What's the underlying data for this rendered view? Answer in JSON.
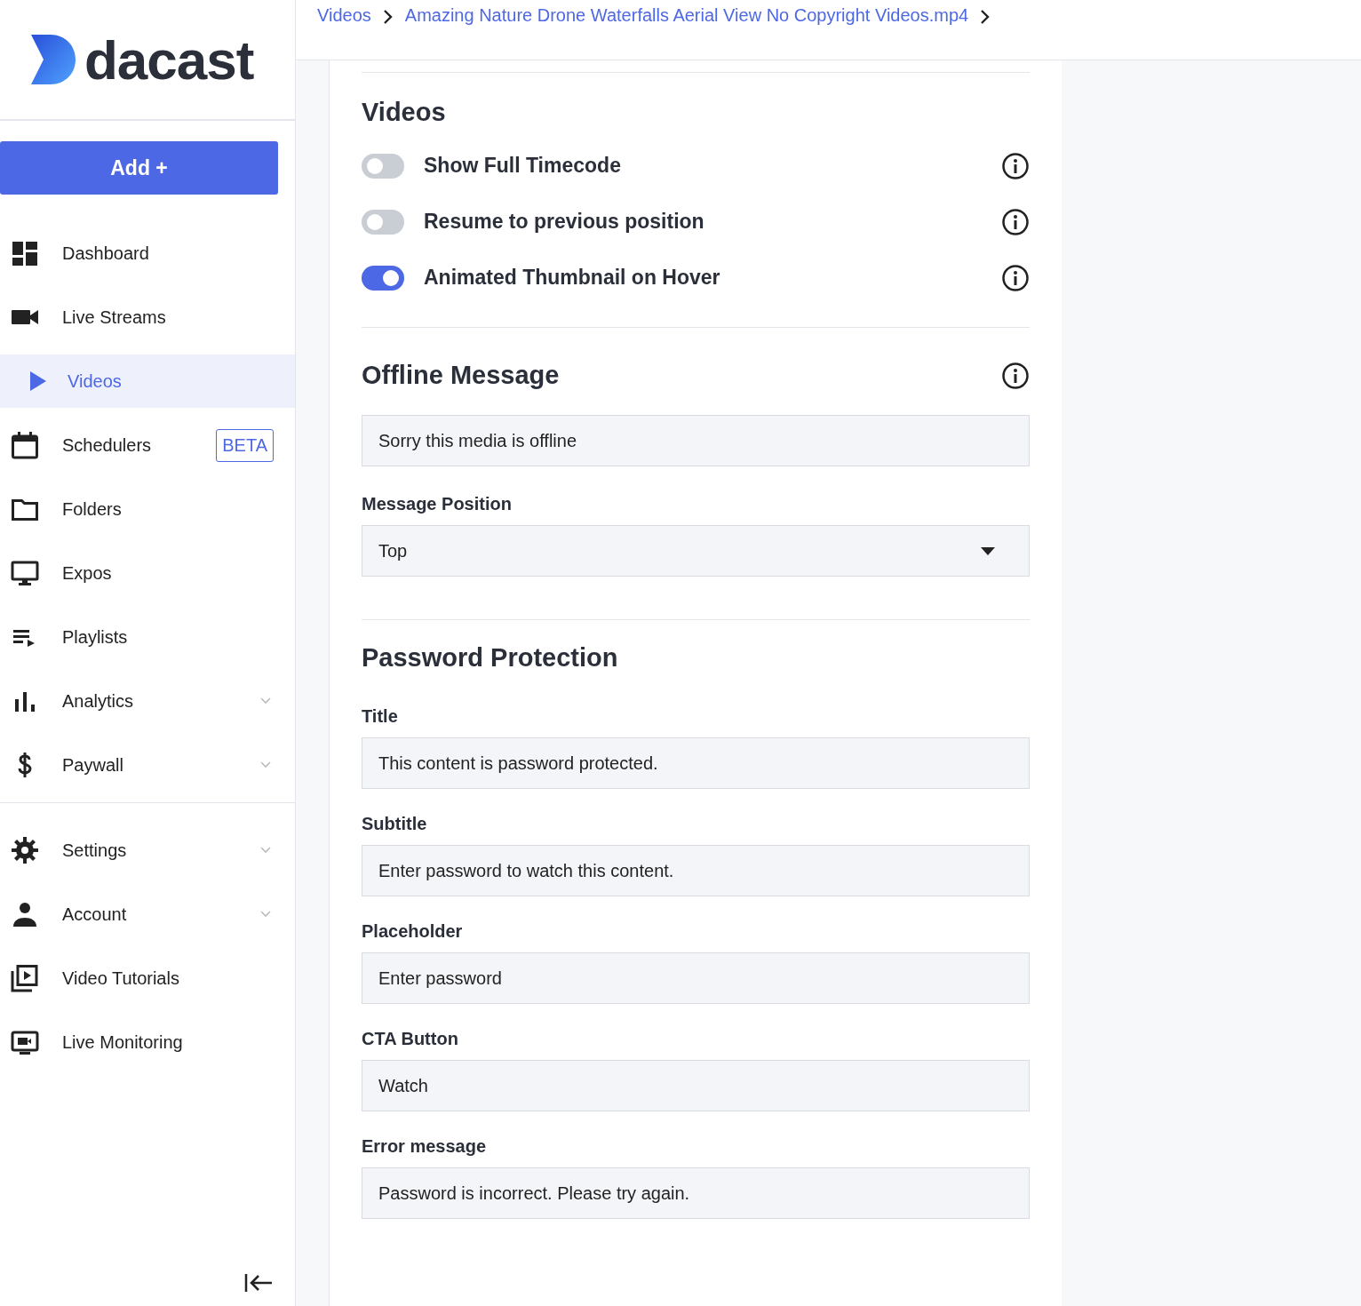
{
  "sidebar": {
    "logo": "dacast",
    "add_button": "Add +",
    "nav_groups": [
      [
        {
          "label": "Dashboard",
          "selected": false
        },
        {
          "label": "Live Streams",
          "selected": false
        },
        {
          "label": "Videos",
          "selected": true
        },
        {
          "label": "Schedulers",
          "selected": false,
          "badge": "BETA"
        },
        {
          "label": "Folders",
          "selected": false
        },
        {
          "label": "Expos",
          "selected": false
        },
        {
          "label": "Playlists",
          "selected": false
        },
        {
          "label": "Analytics",
          "selected": false,
          "expandable": true
        },
        {
          "label": "Paywall",
          "selected": false,
          "expandable": true
        }
      ],
      [
        {
          "label": "Settings",
          "selected": false,
          "expandable": true
        },
        {
          "label": "Account",
          "selected": false,
          "expandable": true
        },
        {
          "label": "Video Tutorials",
          "selected": false
        },
        {
          "label": "Live Monitoring",
          "selected": false
        }
      ]
    ]
  },
  "breadcrumb": [
    "Videos",
    "Amazing Nature Drone Waterfalls Aerial View No Copyright Videos.mp4"
  ],
  "videos_section": {
    "title": "Videos",
    "toggles": [
      {
        "label": "Show Full Timecode",
        "on": false
      },
      {
        "label": "Resume to previous position",
        "on": false
      },
      {
        "label": "Animated Thumbnail on Hover",
        "on": true
      }
    ]
  },
  "offline_section": {
    "title": "Offline Message",
    "message": "Sorry this media is offline",
    "position_label": "Message Position",
    "position_value": "Top"
  },
  "password_section": {
    "title": "Password Protection",
    "fields": [
      {
        "label": "Title",
        "value": "This content is password protected."
      },
      {
        "label": "Subtitle",
        "value": "Enter password to watch this content."
      },
      {
        "label": "Placeholder",
        "value": "Enter password"
      },
      {
        "label": "CTA Button",
        "value": "Watch"
      },
      {
        "label": "Error message",
        "value": "Password is incorrect. Please try again."
      }
    ]
  }
}
